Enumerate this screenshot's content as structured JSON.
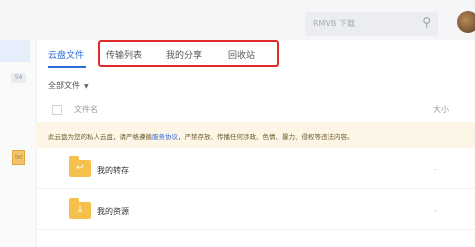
{
  "header": {
    "search_placeholder": "RMVB 下载",
    "search_icon": "search-icon"
  },
  "tabs": [
    {
      "label": "云盘文件",
      "active": true
    },
    {
      "label": "传输列表",
      "active": false
    },
    {
      "label": "我的分享",
      "active": false
    },
    {
      "label": "回收站",
      "active": false
    }
  ],
  "sidebar": {
    "badge": "54",
    "doc_label": "TXT"
  },
  "filter": {
    "label": "全部文件",
    "caret": "▼"
  },
  "columns": {
    "name": "文件名",
    "size": "大小"
  },
  "notice": {
    "text_before": "此云盘为您的私人云盘，请严格遵循",
    "link": "服务协议",
    "text_after": "，严禁存放、传播任何涉政、色情、暴力、侵权等违法内容。"
  },
  "files": [
    {
      "name": "我的转存",
      "size": "-",
      "icon": "folder-transfer-icon"
    },
    {
      "name": "我的资源",
      "size": "-",
      "icon": "folder-download-icon"
    }
  ],
  "colors": {
    "accent": "#2c6cd8",
    "highlight_box": "#e02b2b",
    "folder": "#f5c04c",
    "notice_bg": "#fdf6e6"
  }
}
